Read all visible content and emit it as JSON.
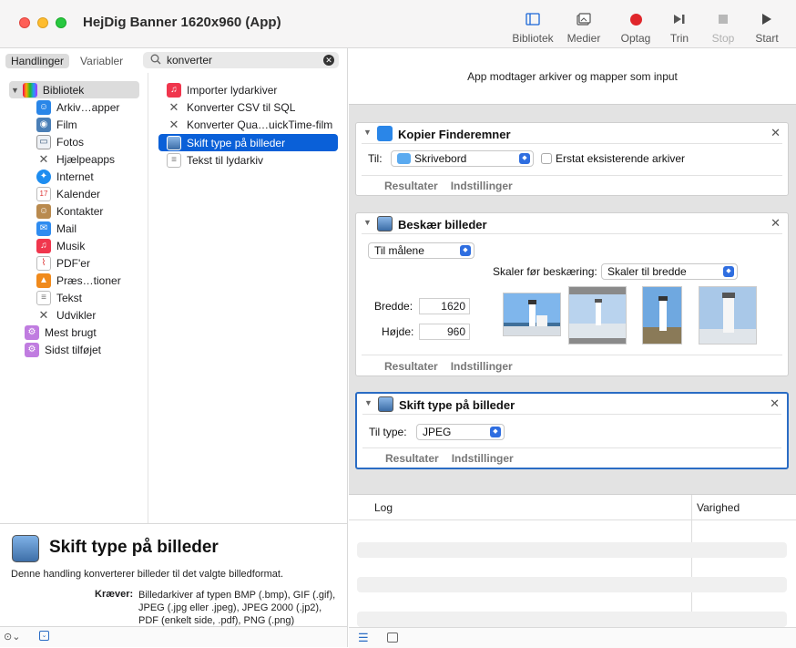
{
  "window": {
    "title": "HejDig Banner 1620x960 (App)"
  },
  "toolbar": {
    "library": "Bibliotek",
    "media": "Medier",
    "record": "Optag",
    "step": "Trin",
    "stop": "Stop",
    "run": "Start"
  },
  "left": {
    "tabs": [
      "Handlinger",
      "Variabler"
    ],
    "search": {
      "value": "konverter"
    },
    "library": {
      "root": "Bibliotek",
      "items": [
        "Arkiv…apper",
        "Film",
        "Fotos",
        "Hjælpeapps",
        "Internet",
        "Kalender",
        "Kontakter",
        "Mail",
        "Musik",
        "PDF'er",
        "Præs…tioner",
        "Tekst",
        "Udvikler"
      ],
      "extra": [
        "Mest brugt",
        "Sidst tilføjet"
      ]
    },
    "actions": [
      "Importer lydarkiver",
      "Konverter CSV til SQL",
      "Konverter Qua…uickTime-film",
      "Skift type på billeder",
      "Tekst til lydarkiv"
    ],
    "description": {
      "title": "Skift type på billeder",
      "text": "Denne handling konverterer billeder til det valgte billedformat.",
      "requires_label": "Kræver:",
      "requires": "Billedarkiver af typen BMP (.bmp), GIF (.gif), JPEG (.jpg eller .jpeg), JPEG 2000 (.jp2), PDF (enkelt side, .pdf), PNG (.png)"
    }
  },
  "workflow": {
    "input_text": "App modtager arkiver og mapper som input",
    "results_tab": "Resultater",
    "options_tab": "Indstillinger",
    "card1": {
      "title": "Kopier Finderemner",
      "to_label": "Til:",
      "to_value": "Skrivebord",
      "replace_label": "Erstat eksisterende arkiver"
    },
    "card2": {
      "title": "Beskær billeder",
      "mode": "Til målene",
      "scale_label": "Skaler før beskæring:",
      "scale_value": "Skaler til bredde",
      "width_label": "Bredde:",
      "width_value": "1620",
      "height_label": "Højde:",
      "height_value": "960"
    },
    "card3": {
      "title": "Skift type på billeder",
      "type_label": "Til type:",
      "type_value": "JPEG"
    }
  },
  "log": {
    "col_log": "Log",
    "col_duration": "Varighed"
  },
  "colors": {
    "accent": "#0a60d8",
    "focus": "#2a6cc4",
    "record": "#e0262b"
  }
}
